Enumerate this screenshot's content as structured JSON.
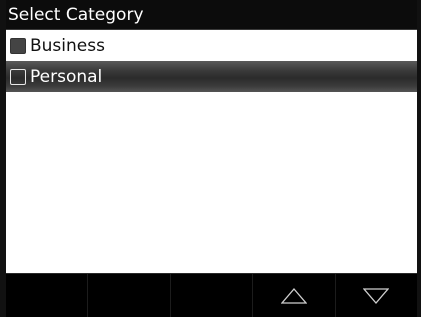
{
  "title": "Select Category",
  "categories": [
    {
      "label": "Business",
      "checked": true,
      "selected": false
    },
    {
      "label": "Personal",
      "checked": false,
      "selected": true
    }
  ],
  "toolbar": {
    "buttons": [
      "blank",
      "blank",
      "blank",
      "up-arrow-icon",
      "down-arrow-icon"
    ]
  }
}
